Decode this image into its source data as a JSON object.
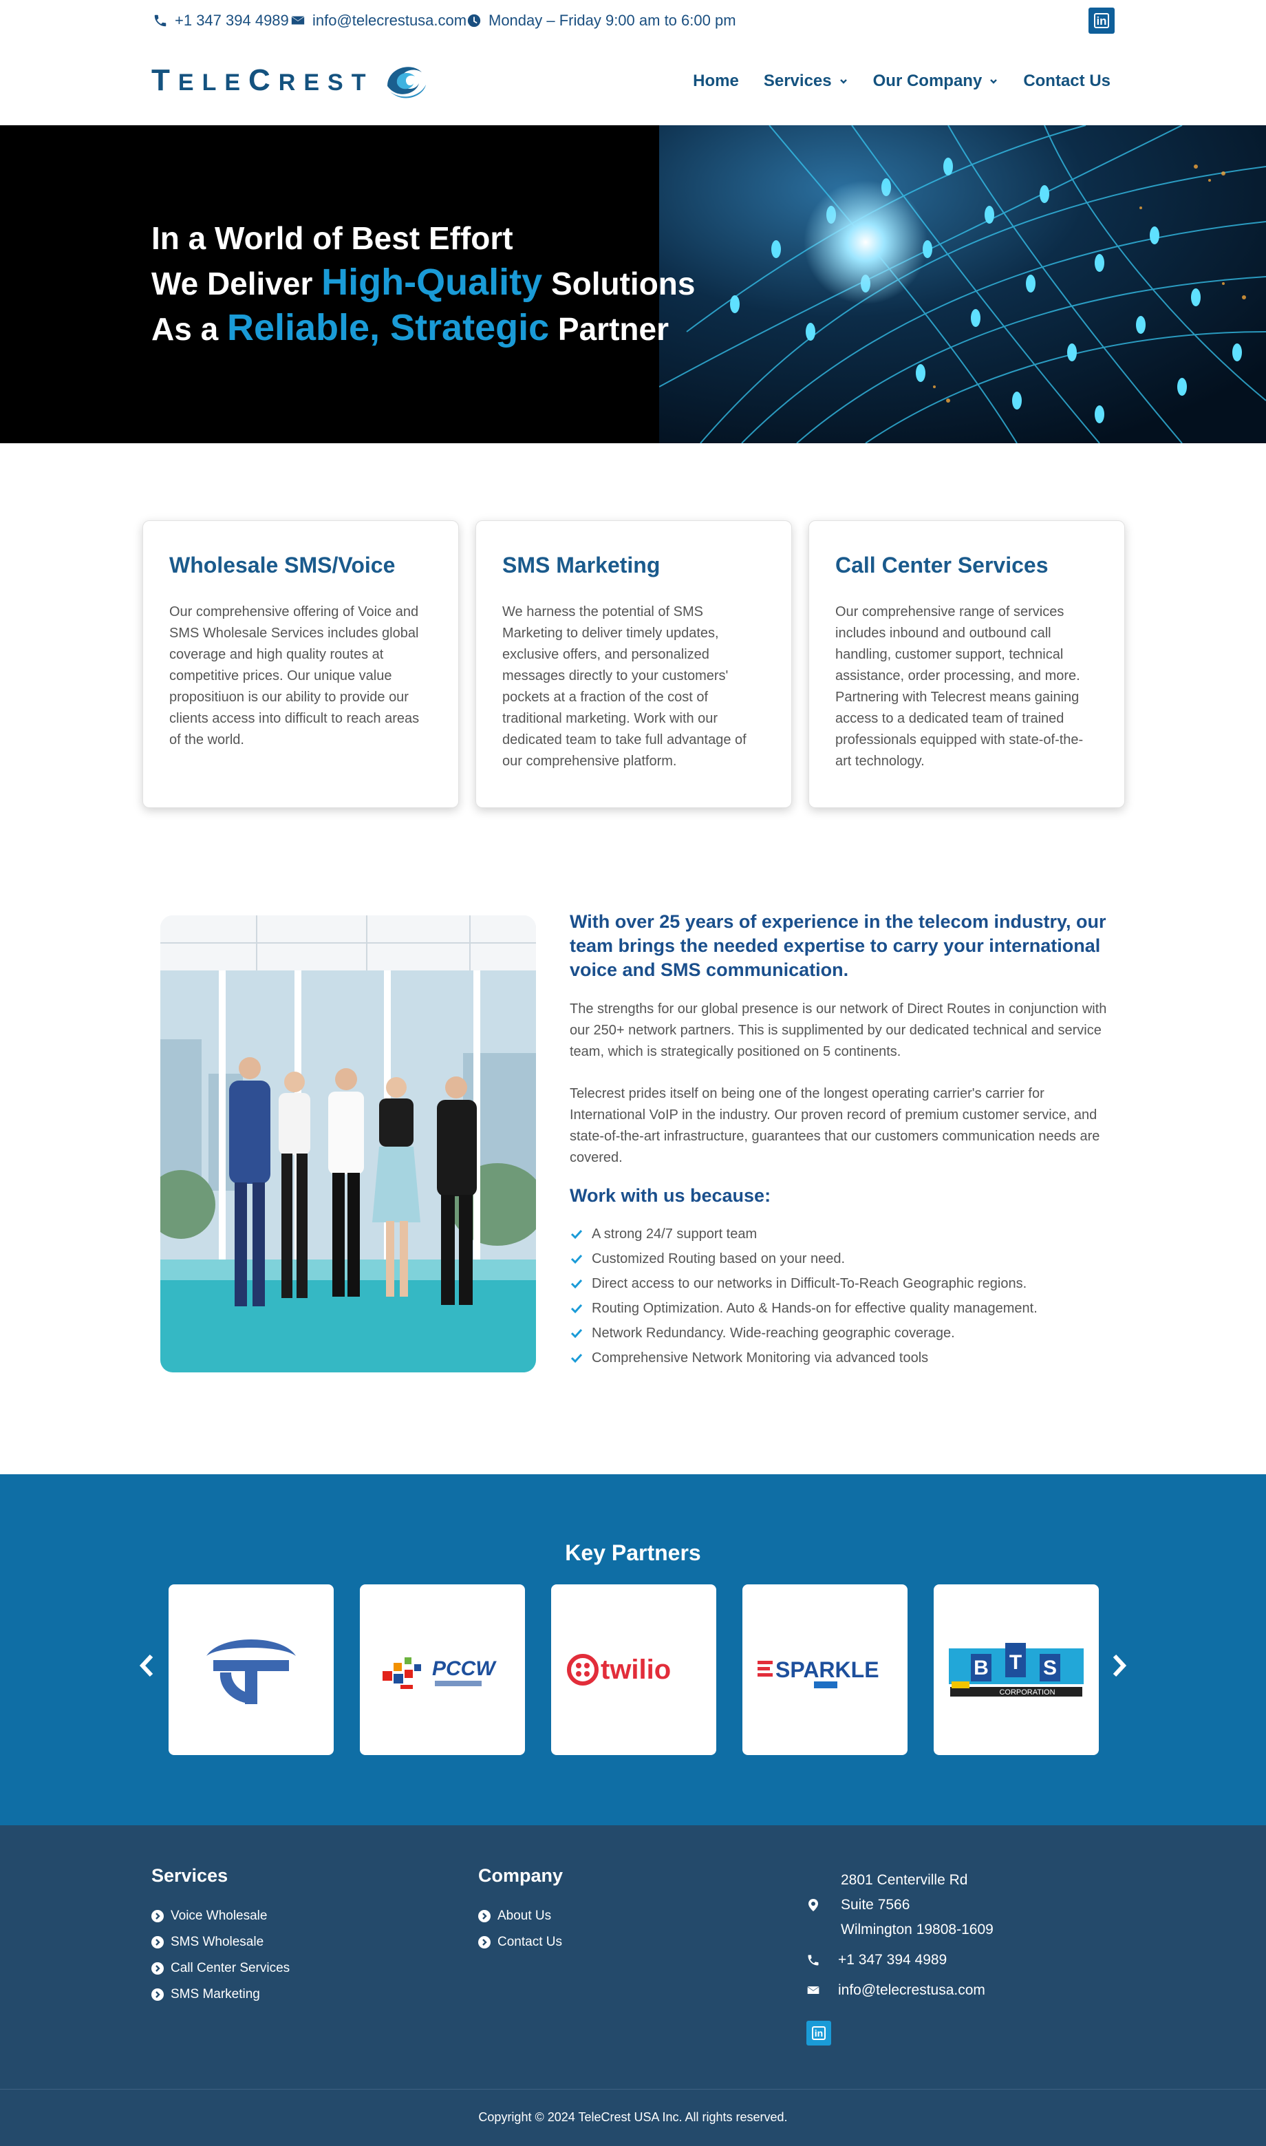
{
  "topbar": {
    "phone": "+1 347 394 4989",
    "email": "info@telecrestusa.com",
    "hours": "Monday – Friday 9:00 am to 6:00 pm"
  },
  "header": {
    "logo_text": "TELECREST",
    "nav": [
      {
        "label": "Home"
      },
      {
        "label": "Services"
      },
      {
        "label": "Our Company"
      },
      {
        "label": "Contact Us"
      }
    ]
  },
  "hero": {
    "line1": "In a World of Best Effort",
    "line2_a": "We Deliver ",
    "line2_hl": "High-Quality",
    "line2_b": " Solutions",
    "line3_a": "As a ",
    "line3_hl": "Reliable, Strategic",
    "line3_b": " Partner"
  },
  "services": [
    {
      "title": "Wholesale SMS/Voice",
      "text": "Our comprehensive offering of Voice and SMS Wholesale Services includes global coverage and high quality routes at competitive prices. Our unique value propositiuon is our ability to provide our clients access into difficult to reach areas of the world."
    },
    {
      "title": "SMS Marketing",
      "text": "We harness the potential of SMS Marketing to deliver timely updates, exclusive offers, and personalized messages directly to your customers' pockets at a fraction of the cost of traditional marketing. Work with our dedicated team to take full advantage of our comprehensive platform."
    },
    {
      "title": "Call Center Services",
      "text": "Our comprehensive range of services includes inbound and outbound call handling, customer support, technical assistance, order processing, and more. Partnering with Telecrest means gaining access to a dedicated team of trained professionals equipped with state-of-the-art technology."
    }
  ],
  "about": {
    "heading": "With over 25 years of experience in the telecom industry, our team brings the needed expertise to carry your international voice and SMS communication.",
    "para1": "The strengths for our global presence is our network of Direct Routes in conjunction with our 250+ network partners. This is supplimented by our dedicated technical and service team, which is strategically positioned on 5 continents.",
    "para2": "Telecrest prides itself on being one of the longest operating carrier's carrier for International VoIP in the industry. Our proven record of premium customer service, and state-of-the-art infrastructure, guarantees that our customers communication needs are covered.",
    "work_heading": "Work with us because:",
    "bullets": [
      "A strong 24/7 support team",
      "Customized Routing based on your need.",
      "Direct access to our networks in Difficult-To-Reach Geographic regions.",
      "Routing Optimization. Auto & Hands-on for effective quality management.",
      "Network Redundancy. Wide-reaching geographic coverage.",
      "Comprehensive Network Monitoring via advanced tools"
    ]
  },
  "partners": {
    "title": "Key Partners",
    "logos": [
      "pccw-text",
      "twilio",
      "SPARKLE",
      "BTS",
      "CORPORATION"
    ],
    "pccw_label": "PCCW",
    "twilio_label": "twilio",
    "sparkle_label": "SPARKLE",
    "bts_letters": [
      "B",
      "T",
      "S"
    ],
    "bts_sub": "CORPORATION"
  },
  "footer": {
    "services_title": "Services",
    "services_links": [
      "Voice Wholesale",
      "SMS Wholesale",
      "Call Center Services",
      "SMS Marketing"
    ],
    "company_title": "Company",
    "company_links": [
      "About Us",
      "Contact Us"
    ],
    "address_line1": "2801 Centerville Rd",
    "address_line2": "Suite 7566",
    "address_line3": "Wilmington 19808-1609",
    "phone": "+1 347 394 4989",
    "email": "info@telecrestusa.com",
    "copyright": "Copyright © 2024 TeleCrest USA Inc. All rights reserved."
  },
  "colors": {
    "brand_blue": "#14527f",
    "accent": "#1a9bd7",
    "partners_bg": "#0f6ea5",
    "footer_bg": "#244a6b"
  }
}
